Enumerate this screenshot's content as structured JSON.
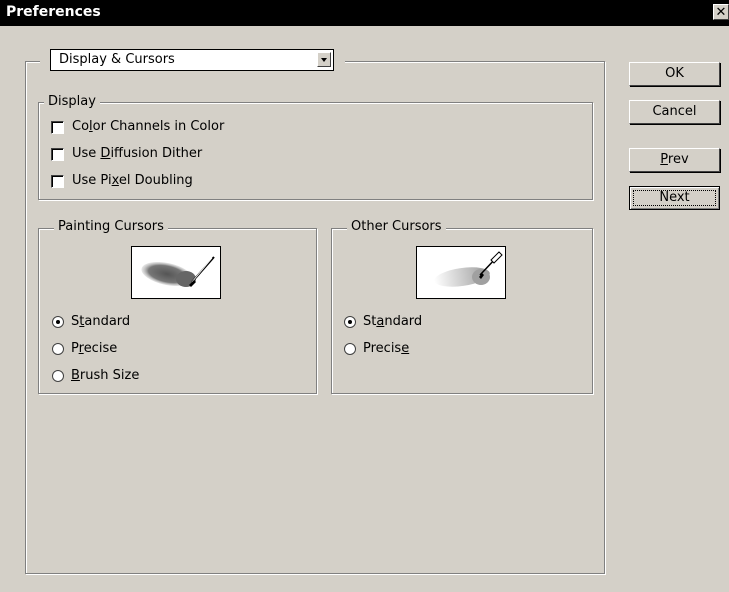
{
  "window": {
    "title": "Preferences",
    "close_glyph": "✕"
  },
  "section_select": {
    "value": "Display & Cursors"
  },
  "display_group": {
    "title": "Display",
    "options": [
      {
        "pre": "Co",
        "key": "l",
        "post": "or Channels in Color",
        "checked": false
      },
      {
        "pre": "Use ",
        "key": "D",
        "post": "iffusion Dither",
        "checked": false
      },
      {
        "pre": "Use Pi",
        "key": "x",
        "post": "el Doubling",
        "checked": false
      }
    ]
  },
  "painting_cursors": {
    "title": "Painting Cursors",
    "preview_icon": "brush-icon",
    "options": [
      {
        "pre": "S",
        "key": "t",
        "post": "andard",
        "selected": true
      },
      {
        "pre": "P",
        "key": "r",
        "post": "ecise",
        "selected": false
      },
      {
        "pre": "",
        "key": "B",
        "post": "rush Size",
        "selected": false
      }
    ]
  },
  "other_cursors": {
    "title": "Other Cursors",
    "preview_icon": "eyedropper-icon",
    "options": [
      {
        "pre": "St",
        "key": "a",
        "post": "ndard",
        "selected": true
      },
      {
        "pre": "Precis",
        "key": "e",
        "post": "",
        "selected": false
      }
    ]
  },
  "buttons": {
    "ok": "OK",
    "cancel": "Cancel",
    "prev_key": "P",
    "prev_rest": "rev",
    "next": "Next"
  }
}
